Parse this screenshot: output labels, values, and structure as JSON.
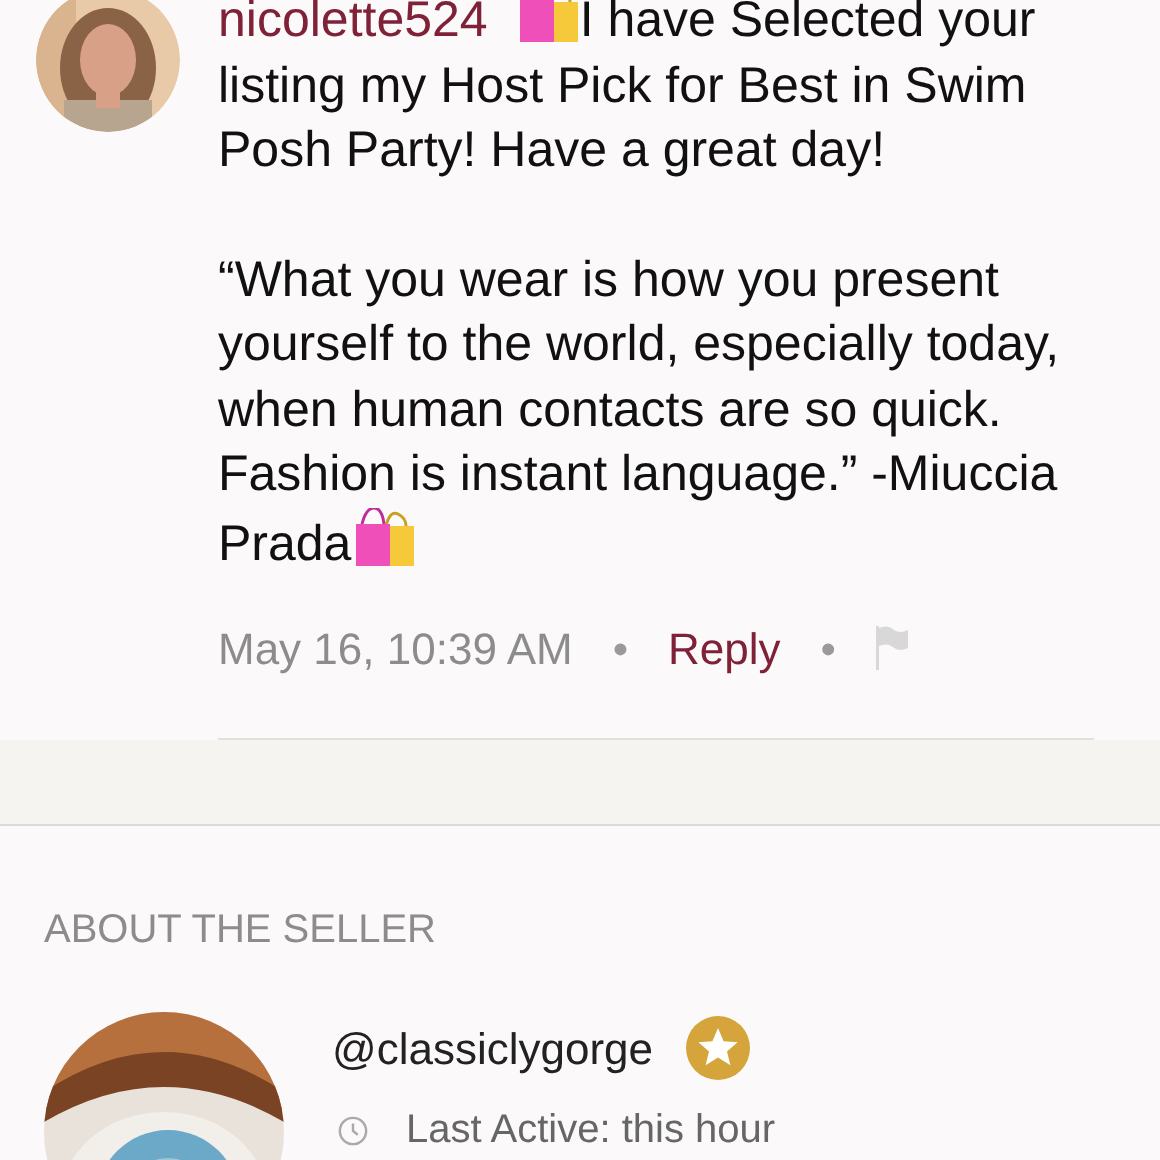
{
  "comment": {
    "username": "nicolette524",
    "paragraphs": [
      {
        "parts": [
          {
            "kind": "icon"
          },
          {
            "kind": "text",
            "text": "I have Selected your listing my Host Pick for Best in Swim Posh Party! Have a great day!"
          }
        ]
      },
      {
        "parts": [
          {
            "kind": "text",
            "text": "“What you wear is how you present yourself to the world, especially today, when human contacts are so quick. Fashion is instant language.” -Miuccia Prada"
          },
          {
            "kind": "icon"
          }
        ]
      }
    ],
    "timestamp": "May 16, 10:39 AM",
    "separator": "•",
    "reply": "Reply"
  },
  "about_seller": {
    "heading": "ABOUT THE SELLER",
    "username": "@classiclygorge",
    "ambassador": true,
    "last_active": "Last Active: this hour"
  }
}
